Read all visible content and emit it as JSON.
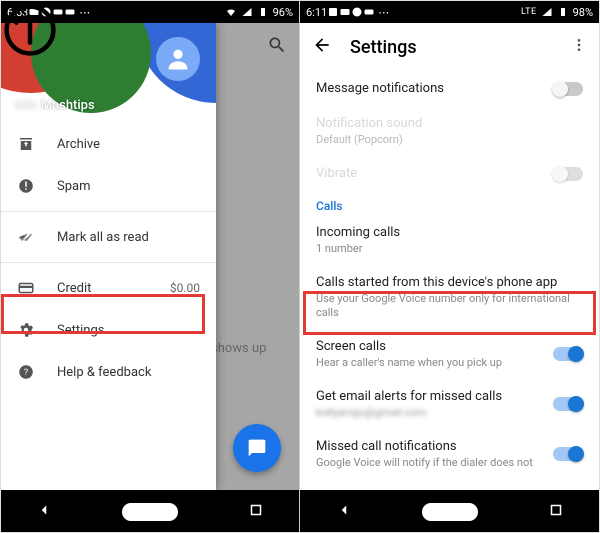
{
  "left": {
    "statusbar": {
      "time": "6:53",
      "battery": "96%"
    },
    "behind": {
      "tab_badge": "1",
      "empty_text": "shows up"
    },
    "drawer": {
      "account_name": "Mashtips",
      "items": {
        "archive": "Archive",
        "spam": "Spam",
        "mark_read": "Mark all as read",
        "credit": "Credit",
        "credit_amount": "$0.00",
        "settings": "Settings",
        "help": "Help & feedback"
      }
    }
  },
  "right": {
    "statusbar": {
      "time": "6:11",
      "battery": "98%",
      "net": "LTE"
    },
    "header": {
      "title": "Settings"
    },
    "settings": {
      "msg_notif": "Message notifications",
      "notif_sound": "Notification sound",
      "notif_sound_val": "Default (Popcorn)",
      "vibrate": "Vibrate",
      "section_calls": "Calls",
      "incoming": "Incoming calls",
      "incoming_sub": "1 number",
      "calls_started": "Calls started from this device's phone app",
      "calls_started_sub": "Use your Google Voice number only for international calls",
      "screen": "Screen calls",
      "screen_sub": "Hear a caller's name when you pick up",
      "email_alerts": "Get email alerts for missed calls",
      "email_alerts_sub": "kollyansju@gmail.com",
      "missed_notif": "Missed call notifications",
      "missed_notif_sub": "Google Voice will notify if the dialer does not"
    }
  }
}
